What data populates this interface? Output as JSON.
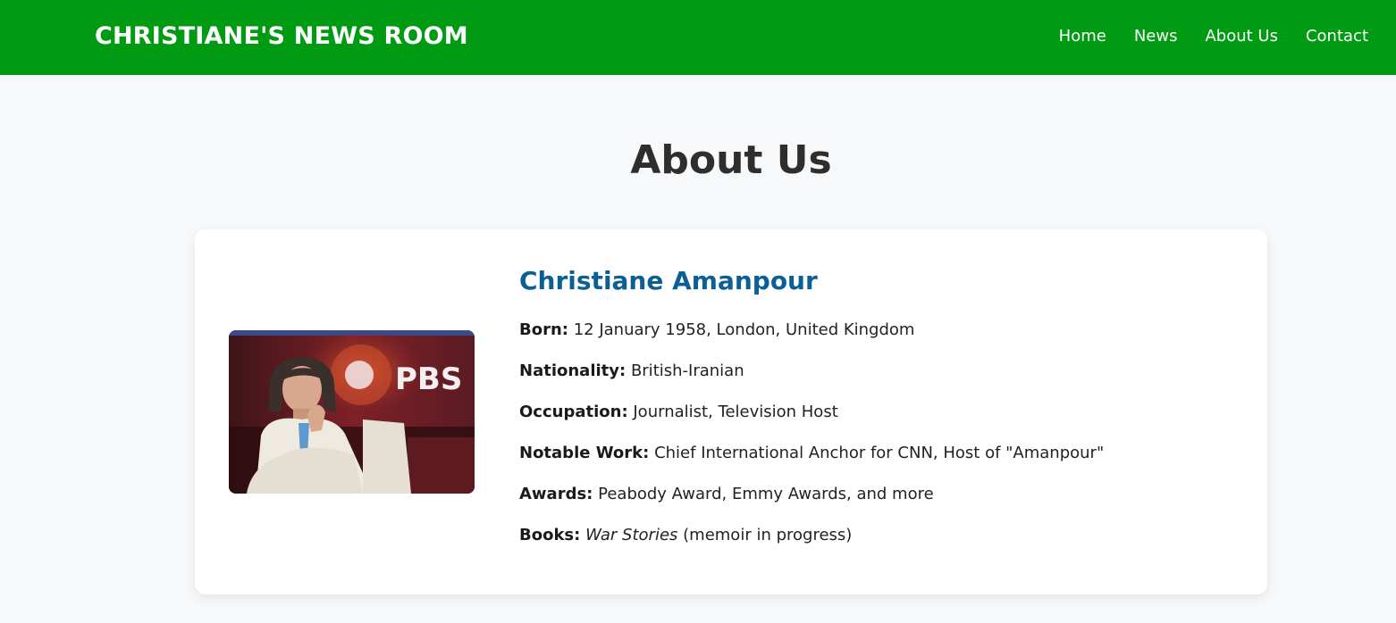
{
  "header": {
    "brand": "CHRISTIANE'S NEWS ROOM",
    "nav": [
      "Home",
      "News",
      "About Us",
      "Contact"
    ],
    "bar_color": "#009b12"
  },
  "page": {
    "title": "About Us"
  },
  "profile": {
    "name": "Christiane Amanpour",
    "photo_alt": "Christiane Amanpour seated in front of a PBS logo",
    "photo_logo_text": "PBS",
    "born_label": "Born:",
    "born_value": "12 January 1958, London, United Kingdom",
    "nationality_label": "Nationality:",
    "nationality_value": "British-Iranian",
    "occupation_label": "Occupation:",
    "occupation_value": "Journalist, Television Host",
    "work_label": "Notable Work:",
    "work_value": "Chief International Anchor for CNN, Host of \"Amanpour\"",
    "awards_label": "Awards:",
    "awards_value": "Peabody Award, Emmy Awards, and more",
    "books_label": "Books:",
    "books_title": "War Stories",
    "books_note": "(memoir in progress)"
  },
  "colors": {
    "accent_name": "#0b5f94",
    "background": "#f7f8fa"
  }
}
